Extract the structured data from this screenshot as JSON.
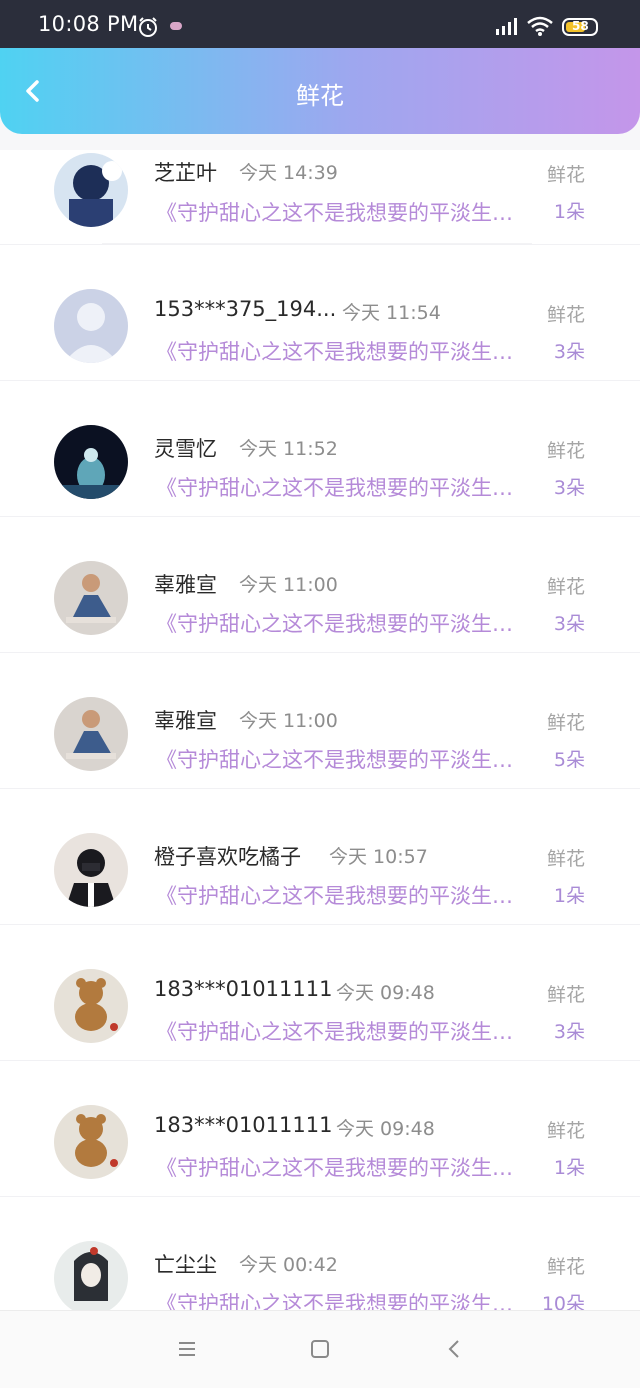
{
  "status": {
    "time": "10:08 PM",
    "battery": "58"
  },
  "header": {
    "title": "鲜花"
  },
  "items": [
    {
      "name": "芝芷叶",
      "time": "今天 14:39",
      "book": "《守护甜心之这不是我想要的平淡生活》",
      "gift": "鲜花",
      "count": "1朵",
      "avatar_colors": [
        "#1d2e57",
        "#d7e4f1"
      ]
    },
    {
      "name": "153***375_194...",
      "time": "今天 11:54",
      "book": "《守护甜心之这不是我想要的平淡生活》",
      "gift": "鲜花",
      "count": "3朵",
      "avatar_colors": [
        "#cbd2e6",
        "#eef1f8"
      ]
    },
    {
      "name": "灵雪忆",
      "time": "今天 11:52",
      "book": "《守护甜心之这不是我想要的平淡生活》",
      "gift": "鲜花",
      "count": "3朵",
      "avatar_colors": [
        "#0b1122",
        "#5fa6b8"
      ]
    },
    {
      "name": "辜雅宣",
      "time": "今天 11:00",
      "book": "《守护甜心之这不是我想要的平淡生活》",
      "gift": "鲜花",
      "count": "3朵",
      "avatar_colors": [
        "#d9d4cf",
        "#3d5c8c"
      ]
    },
    {
      "name": "辜雅宣",
      "time": "今天 11:00",
      "book": "《守护甜心之这不是我想要的平淡生活》",
      "gift": "鲜花",
      "count": "5朵",
      "avatar_colors": [
        "#d9d4cf",
        "#3d5c8c"
      ]
    },
    {
      "name": "橙子喜欢吃橘子",
      "time": "今天 10:57",
      "book": "《守护甜心之这不是我想要的平淡生活》",
      "gift": "鲜花",
      "count": "1朵",
      "avatar_colors": [
        "#1a1a1f",
        "#e9e3de"
      ]
    },
    {
      "name": "183***01011111",
      "time": "今天 09:48",
      "book": "《守护甜心之这不是我想要的平淡生活》",
      "gift": "鲜花",
      "count": "3朵",
      "avatar_colors": [
        "#e6e1d8",
        "#b27a3e"
      ]
    },
    {
      "name": "183***01011111",
      "time": "今天 09:48",
      "book": "《守护甜心之这不是我想要的平淡生活》",
      "gift": "鲜花",
      "count": "1朵",
      "avatar_colors": [
        "#e6e1d8",
        "#b27a3e"
      ]
    },
    {
      "name": "亡尘尘",
      "time": "今天 00:42",
      "book": "《守护甜心之这不是我想要的平淡生活》",
      "gift": "鲜花",
      "count": "10朵",
      "avatar_colors": [
        "#e8eceb",
        "#2b2f35"
      ]
    }
  ],
  "colors": {
    "accent": "#b58ad8",
    "header_left": "#4fd2f2",
    "header_right": "#c496ea"
  }
}
